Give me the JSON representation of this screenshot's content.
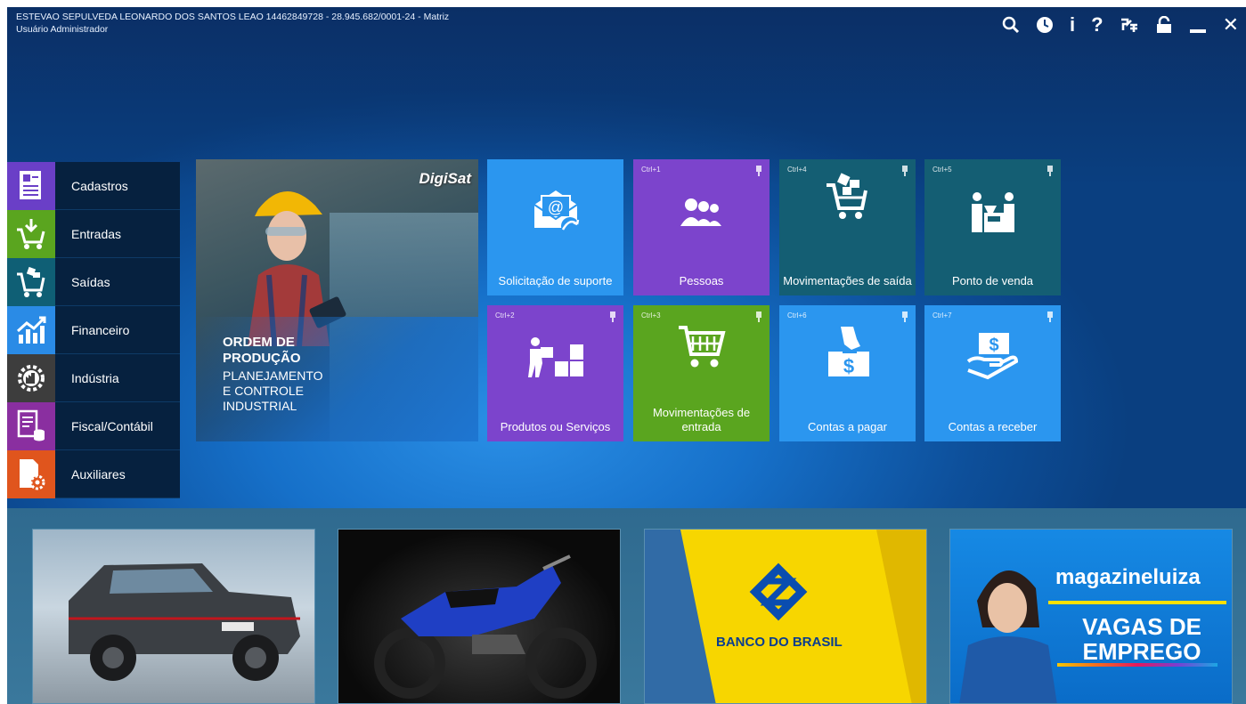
{
  "header": {
    "company": "ESTEVAO SEPULVEDA LEONARDO DOS SANTOS LEAO 14462849728 - 28.945.682/0001-24 - Matriz",
    "user": "Usuário Administrador"
  },
  "toolbar": {
    "icons": [
      "search-icon",
      "clock-icon",
      "info-icon",
      "help-icon",
      "users-icon",
      "lock-icon",
      "minimize-icon",
      "close-icon"
    ],
    "info_glyph": "i",
    "help_glyph": "?",
    "close_glyph": "✕"
  },
  "menu": {
    "items": [
      {
        "label": "Cadastros",
        "icon": "document-list-icon",
        "color": "#6a3fc7"
      },
      {
        "label": "Entradas",
        "icon": "cart-in-icon",
        "color": "#5aa51f"
      },
      {
        "label": "Saídas",
        "icon": "cart-out-icon",
        "color": "#0f5f75"
      },
      {
        "label": "Financeiro",
        "icon": "chart-up-icon",
        "color": "#2a8be6"
      },
      {
        "label": "Indústria",
        "icon": "factory-gear-icon",
        "color": "#3d3d3d"
      },
      {
        "label": "Fiscal/Contábil",
        "icon": "fiscal-doc-icon",
        "color": "#8a2fa0"
      },
      {
        "label": "Auxiliares",
        "icon": "doc-gear-icon",
        "color": "#e0551d"
      }
    ]
  },
  "banner": {
    "logo": "DigiSat",
    "title_line1": "ORDEM DE",
    "title_line2": "PRODUÇÃO",
    "sub_line1": "PLANEJAMENTO",
    "sub_line2": "E CONTROLE",
    "sub_line3": "INDUSTRIAL"
  },
  "tiles": [
    {
      "label": "Solicitação de suporte",
      "shortcut": "",
      "color": "#2b96ef",
      "icon": "email-at-icon"
    },
    {
      "label": "Pessoas",
      "shortcut": "Ctrl+1",
      "color": "#7c44cc",
      "icon": "people-icon"
    },
    {
      "label": "Movimentações de saída",
      "shortcut": "Ctrl+4",
      "color": "#145e73",
      "icon": "cart-boxes-icon"
    },
    {
      "label": "Ponto de venda",
      "shortcut": "Ctrl+5",
      "color": "#145e73",
      "icon": "cashier-icon"
    },
    {
      "label": "Produtos ou Serviços",
      "shortcut": "Ctrl+2",
      "color": "#7c44cc",
      "icon": "boxes-person-icon"
    },
    {
      "label": "Movimentações de entrada",
      "shortcut": "Ctrl+3",
      "color": "#5aa51f",
      "icon": "cart-icon"
    },
    {
      "label": "Contas a pagar",
      "shortcut": "Ctrl+6",
      "color": "#2b96ef",
      "icon": "pay-hand-icon"
    },
    {
      "label": "Contas a receber",
      "shortcut": "Ctrl+7",
      "color": "#2b96ef",
      "icon": "receive-hand-icon"
    }
  ],
  "ads": {
    "bank_name": "BANCO DO BRASIL",
    "store_name": "magazineluiza",
    "store_text": "VAGAS DE EMPREGO"
  }
}
